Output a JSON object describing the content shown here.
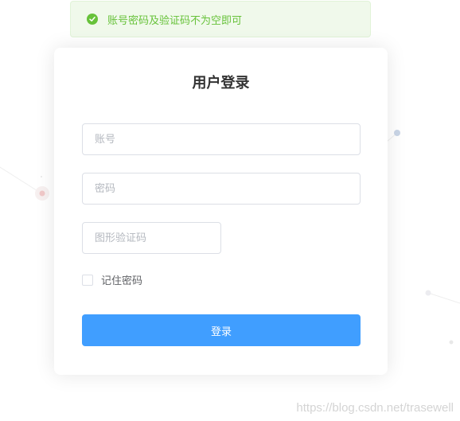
{
  "toast": {
    "message": "账号密码及验证码不为空即可",
    "icon": "success-check-icon",
    "color": "#67c23a"
  },
  "login": {
    "title": "用户登录",
    "account_placeholder": "账号",
    "account_value": "",
    "password_placeholder": "密码",
    "password_value": "",
    "captcha_placeholder": "图形验证码",
    "captcha_value": "",
    "remember_label": "记住密码",
    "remember_checked": false,
    "submit_label": "登录",
    "accent": "#409eff"
  },
  "watermark": "https://blog.csdn.net/trasewell"
}
